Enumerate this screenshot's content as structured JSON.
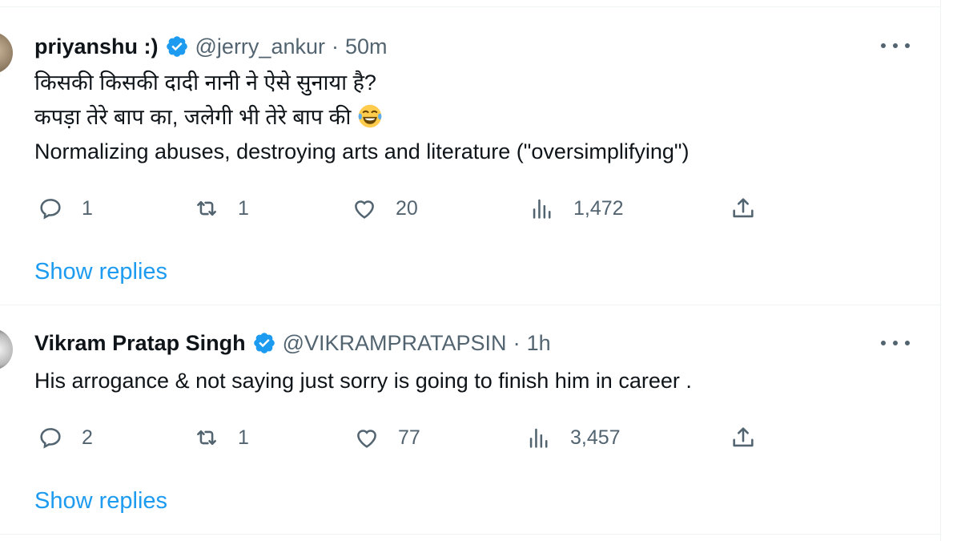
{
  "tweets": [
    {
      "name": "priyanshu :)",
      "handle": "@jerry_ankur",
      "separator": "·",
      "time": "50m",
      "lines": [
        "किसकी किसकी दादी नानी ने ऐसे सुनाया है?",
        "कपड़ा तेरे बाप का,  जलेगी भी तेरे बाप की",
        "Normalizing abuses, destroying arts and literature (\"oversimplifying\")"
      ],
      "emoji": "😂",
      "replies": "1",
      "retweets": "1",
      "likes": "20",
      "views": "1,472",
      "show_replies": "Show replies"
    },
    {
      "name": "Vikram Pratap Singh",
      "handle": "@VIKRAMPRATAPSIN",
      "separator": "·",
      "time": "1h",
      "lines": [
        "His arrogance & not saying just sorry is going to finish him in career ."
      ],
      "replies": "2",
      "retweets": "1",
      "likes": "77",
      "views": "3,457",
      "show_replies": "Show replies"
    }
  ],
  "colors": {
    "accent": "#1d9bf0",
    "secondary_text": "#536471",
    "primary_text": "#0f1419",
    "divider": "#eff3f4"
  },
  "icons": [
    "verified-badge-icon",
    "more-icon",
    "reply-icon",
    "retweet-icon",
    "like-icon",
    "views-icon",
    "share-icon",
    "laughing-emoji-icon"
  ]
}
